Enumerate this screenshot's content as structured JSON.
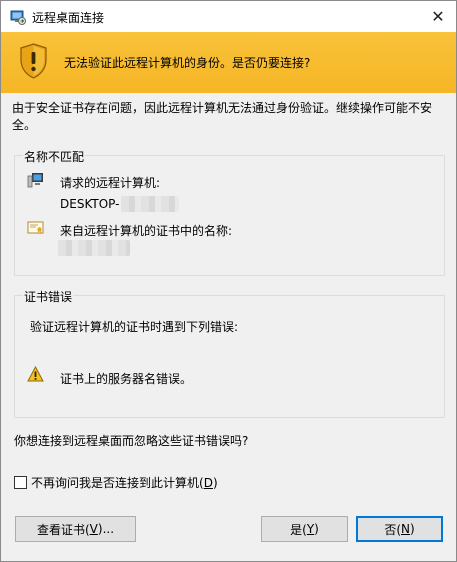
{
  "window": {
    "title": "远程桌面连接",
    "close_glyph": "✕"
  },
  "banner": {
    "message": "无法验证此远程计算机的身份。是否仍要连接?",
    "color": "#f8c23a"
  },
  "intro_text": "由于安全证书存在问题，因此远程计算机无法通过身份验证。继续操作可能不安全。",
  "name_mismatch": {
    "group_label": "名称不匹配",
    "requested_label": "请求的远程计算机:",
    "requested_value": "DESKTOP-",
    "cert_name_label": "来自远程计算机的证书中的名称:"
  },
  "cert_errors": {
    "group_label": "证书错误",
    "description": "验证远程计算机的证书时遇到下列错误:",
    "error_item": "证书上的服务器名错误。"
  },
  "question": "你想连接到远程桌面而忽略这些证书错误吗?",
  "dont_ask": {
    "label_prefix": "不再询问我是否连接到此计算机(",
    "label_key": "D",
    "label_suffix": ")",
    "checked": false
  },
  "buttons": {
    "view_cert": {
      "prefix": "查看证书(",
      "key": "V",
      "suffix": ")..."
    },
    "yes": {
      "prefix": "是(",
      "key": "Y",
      "suffix": ")"
    },
    "no": {
      "prefix": "否(",
      "key": "N",
      "suffix": ")"
    }
  },
  "icons": {
    "app": "remote-desktop-icon",
    "banner": "warning-shield-icon",
    "computer": "computer-icon",
    "certificate": "certificate-icon",
    "warning": "warning-triangle-icon"
  }
}
